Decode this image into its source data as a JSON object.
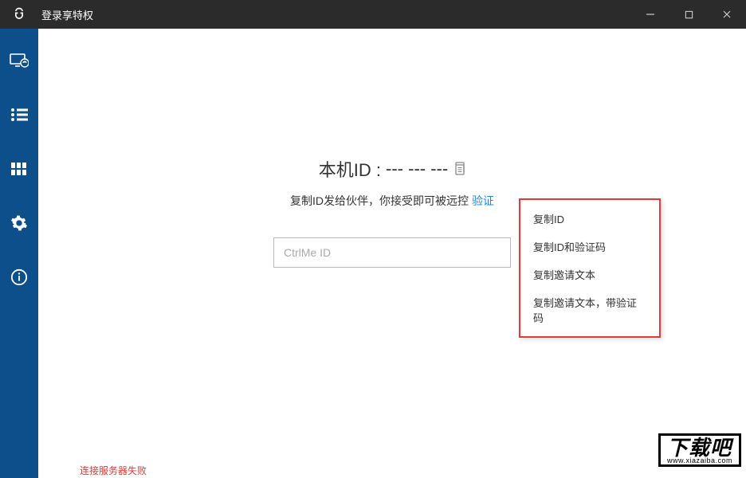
{
  "titlebar": {
    "title": "登录享特权"
  },
  "sidebar": {
    "items": [
      {
        "name": "remote"
      },
      {
        "name": "list"
      },
      {
        "name": "grid"
      },
      {
        "name": "settings"
      },
      {
        "name": "info"
      }
    ]
  },
  "main": {
    "id_label": "本机ID :",
    "id_value": "--- --- ---",
    "desc_text": "复制ID发给伙伴，你接受即可被远控  ",
    "desc_link": "验证",
    "input_placeholder": "CtrlMe ID"
  },
  "context_menu": {
    "items": [
      "复制ID",
      "复制ID和验证码",
      "复制邀请文本",
      "复制邀请文本，带验证码"
    ]
  },
  "status": {
    "text": "连接服务器失败"
  },
  "watermark": {
    "brand": "下载吧",
    "url": "www.xiazaiba.com"
  }
}
